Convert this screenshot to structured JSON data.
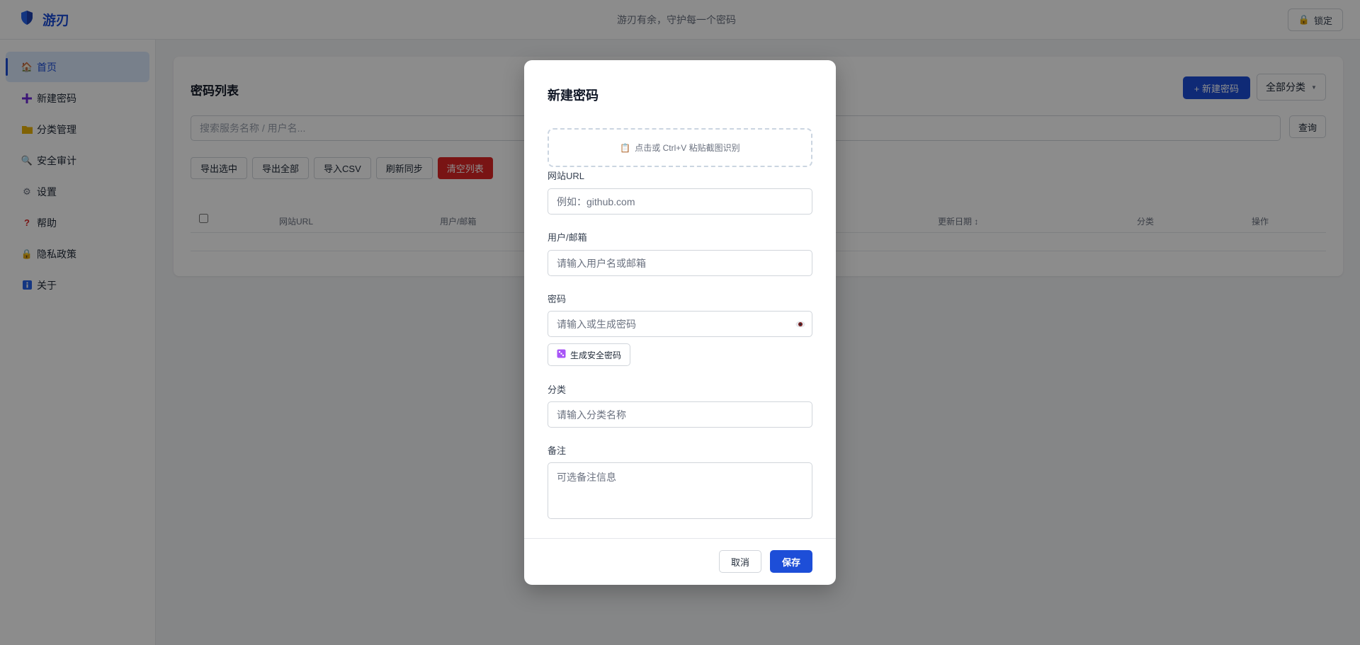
{
  "app": {
    "name": "游刃",
    "slogan": "游刃有余，守护每一个密码",
    "lock_label": "锁定"
  },
  "sidebar": {
    "items": [
      {
        "label": "首页",
        "icon": "home-icon",
        "active": true
      },
      {
        "label": "新建密码",
        "icon": "plus-icon",
        "active": false
      },
      {
        "label": "分类管理",
        "icon": "folder-icon",
        "active": false
      },
      {
        "label": "安全审计",
        "icon": "magnifier-icon",
        "active": false
      },
      {
        "label": "设置",
        "icon": "gear-icon",
        "active": false
      },
      {
        "label": "帮助",
        "icon": "question-icon",
        "active": false
      },
      {
        "label": "隐私政策",
        "icon": "lock-icon",
        "active": false
      },
      {
        "label": "关于",
        "icon": "info-icon",
        "active": false
      }
    ]
  },
  "main": {
    "title": "密码列表",
    "new_button": "+ 新建密码",
    "category_filter": "全部分类",
    "search_placeholder": "搜索服务名称 / 用户名...",
    "query_button": "查询",
    "actions": {
      "export_selected": "导出选中",
      "export_all": "导出全部",
      "import_csv": "导入CSV",
      "refresh_sync": "刷新同步",
      "clear_list": "清空列表"
    },
    "columns": {
      "url": "网站URL",
      "user": "用户/邮箱",
      "updated": "更新日期 ↕",
      "category": "分类",
      "ops": "操作"
    }
  },
  "modal": {
    "title": "新建密码",
    "paste_hint": "点击或 Ctrl+V 粘贴截图识别",
    "url_label": "网站URL",
    "url_placeholder": "例如：github.com",
    "user_label": "用户/邮箱",
    "user_placeholder": "请输入用户名或邮箱",
    "password_label": "密码",
    "password_placeholder": "请输入或生成密码",
    "generate_button": "生成安全密码",
    "category_label": "分类",
    "category_placeholder": "请输入分类名称",
    "notes_label": "备注",
    "notes_placeholder": "可选备注信息",
    "cancel": "取消",
    "save": "保存"
  },
  "colors": {
    "primary": "#1d4ed8",
    "danger": "#dc2626",
    "active_bg": "#dbeafe"
  }
}
